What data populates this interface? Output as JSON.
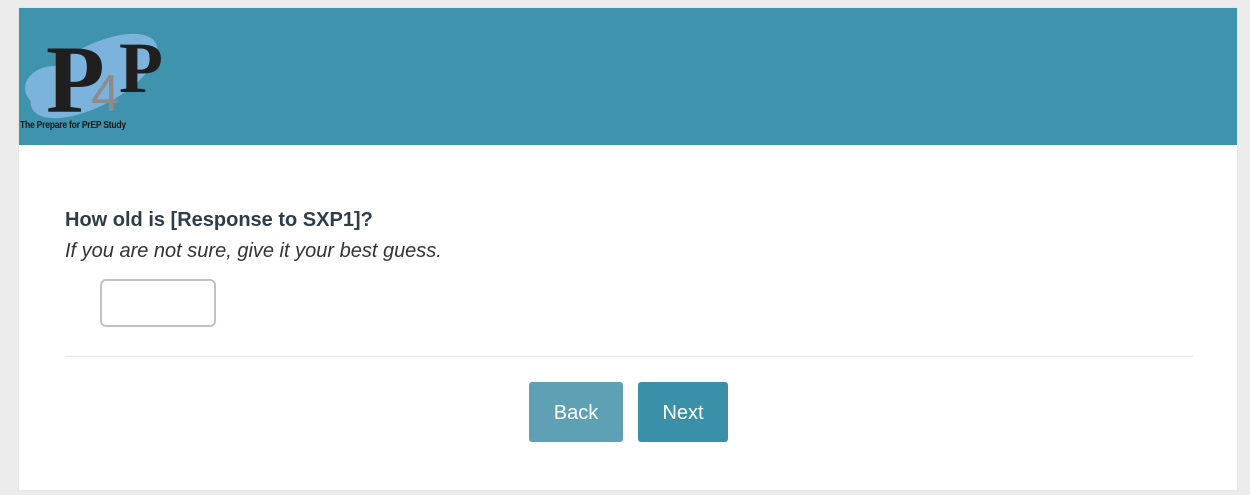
{
  "header": {
    "logo_caption": "The Prepare for PrEP Study",
    "background_color": "#3f93ad",
    "logo": {
      "letter_left": "P",
      "digit": "4",
      "letter_right": "P"
    }
  },
  "question": {
    "title": "How old is [Response to SXP1]?",
    "hint": "If you are not sure, give it your best guess.",
    "answer_value": "",
    "answer_placeholder": ""
  },
  "navigation": {
    "back_label": "Back",
    "next_label": "Next",
    "back_color": "#5ea1b5",
    "next_color": "#3a8fa9"
  }
}
